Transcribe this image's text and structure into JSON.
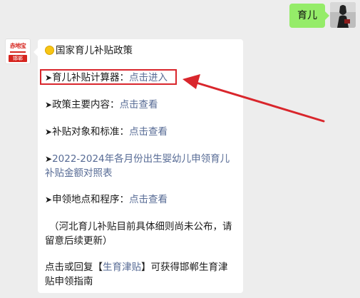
{
  "chat": {
    "outgoing": {
      "text": "育儿"
    },
    "incoming": {
      "avatar_logo_top": "赤地宝",
      "avatar_logo_bottom": "邯郸",
      "title_icon": "sun-icon",
      "title": "国家育儿补贴政策",
      "items": [
        {
          "bullet": "➤",
          "label": "育儿补贴计算器：",
          "link": "点击进入"
        },
        {
          "bullet": "➤",
          "label": "政策主要内容：",
          "link": "点击查看"
        },
        {
          "bullet": "➤",
          "label": "补贴对象和标准：",
          "link": "点击查看"
        },
        {
          "bullet": "➤",
          "link_line1": "2022-2024年各月份出生婴幼儿申领育儿",
          "link_line2": "补贴金额对照表"
        },
        {
          "bullet": "➤",
          "label": "申领地点和程序：",
          "link": "点击查看"
        }
      ],
      "note_line1": "（河北育儿补贴目前具体细则尚未公布，请",
      "note_line2": "留意后续更新）",
      "footer_pre": "点击或回复【",
      "footer_link": "生育津贴",
      "footer_post": "】可获得邯郸生育津",
      "footer_line2": "贴申领指南"
    }
  },
  "colors": {
    "link": "#576b95",
    "outgoing_bubble": "#95ec69",
    "annotation_red": "#d9262c"
  }
}
